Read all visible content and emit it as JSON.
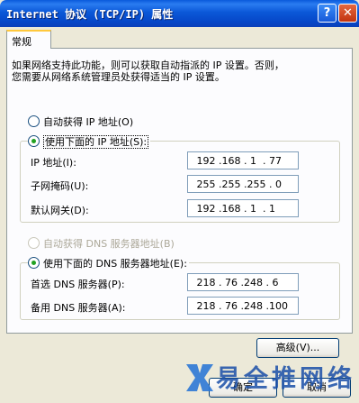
{
  "window": {
    "title": "Internet 协议 (TCP/IP) 属性",
    "help_glyph": "?",
    "close_glyph": "✕"
  },
  "tab": {
    "label": "常规"
  },
  "intro": {
    "line1": "如果网络支持此功能，则可以获取自动指派的 IP 设置。否则，",
    "line2": "您需要从网络系统管理员处获得适当的 IP 设置。"
  },
  "ip_mode": {
    "auto_label": "自动获得 IP 地址(O)",
    "manual_label": "使用下面的 IP 地址(S):",
    "selected": "manual"
  },
  "ip_fields": {
    "ip_label": "IP 地址(I):",
    "ip_value": " 192 .168 . 1  . 77",
    "mask_label": "子网掩码(U):",
    "mask_value": " 255 .255 .255 . 0",
    "gateway_label": "默认网关(D):",
    "gateway_value": " 192 .168 . 1  . 1"
  },
  "dns_mode": {
    "auto_label": "自动获得 DNS 服务器地址(B)",
    "manual_label": "使用下面的 DNS 服务器地址(E):",
    "selected": "manual"
  },
  "dns_fields": {
    "preferred_label": "首选 DNS 服务器(P):",
    "preferred_value": " 218 . 76 .248 . 6",
    "alternate_label": "备用 DNS 服务器(A):",
    "alternate_value": " 218 . 76 .248 .100"
  },
  "buttons": {
    "advanced": "高级(V)...",
    "ok": "确定",
    "cancel": "取消"
  },
  "watermark": {
    "text": "易全推网络"
  },
  "colors": {
    "titlebar": "#0B58D8",
    "dialog_bg": "#ECE9D8",
    "radio_on": "#21A121",
    "watermark": "#1A4FA8"
  }
}
